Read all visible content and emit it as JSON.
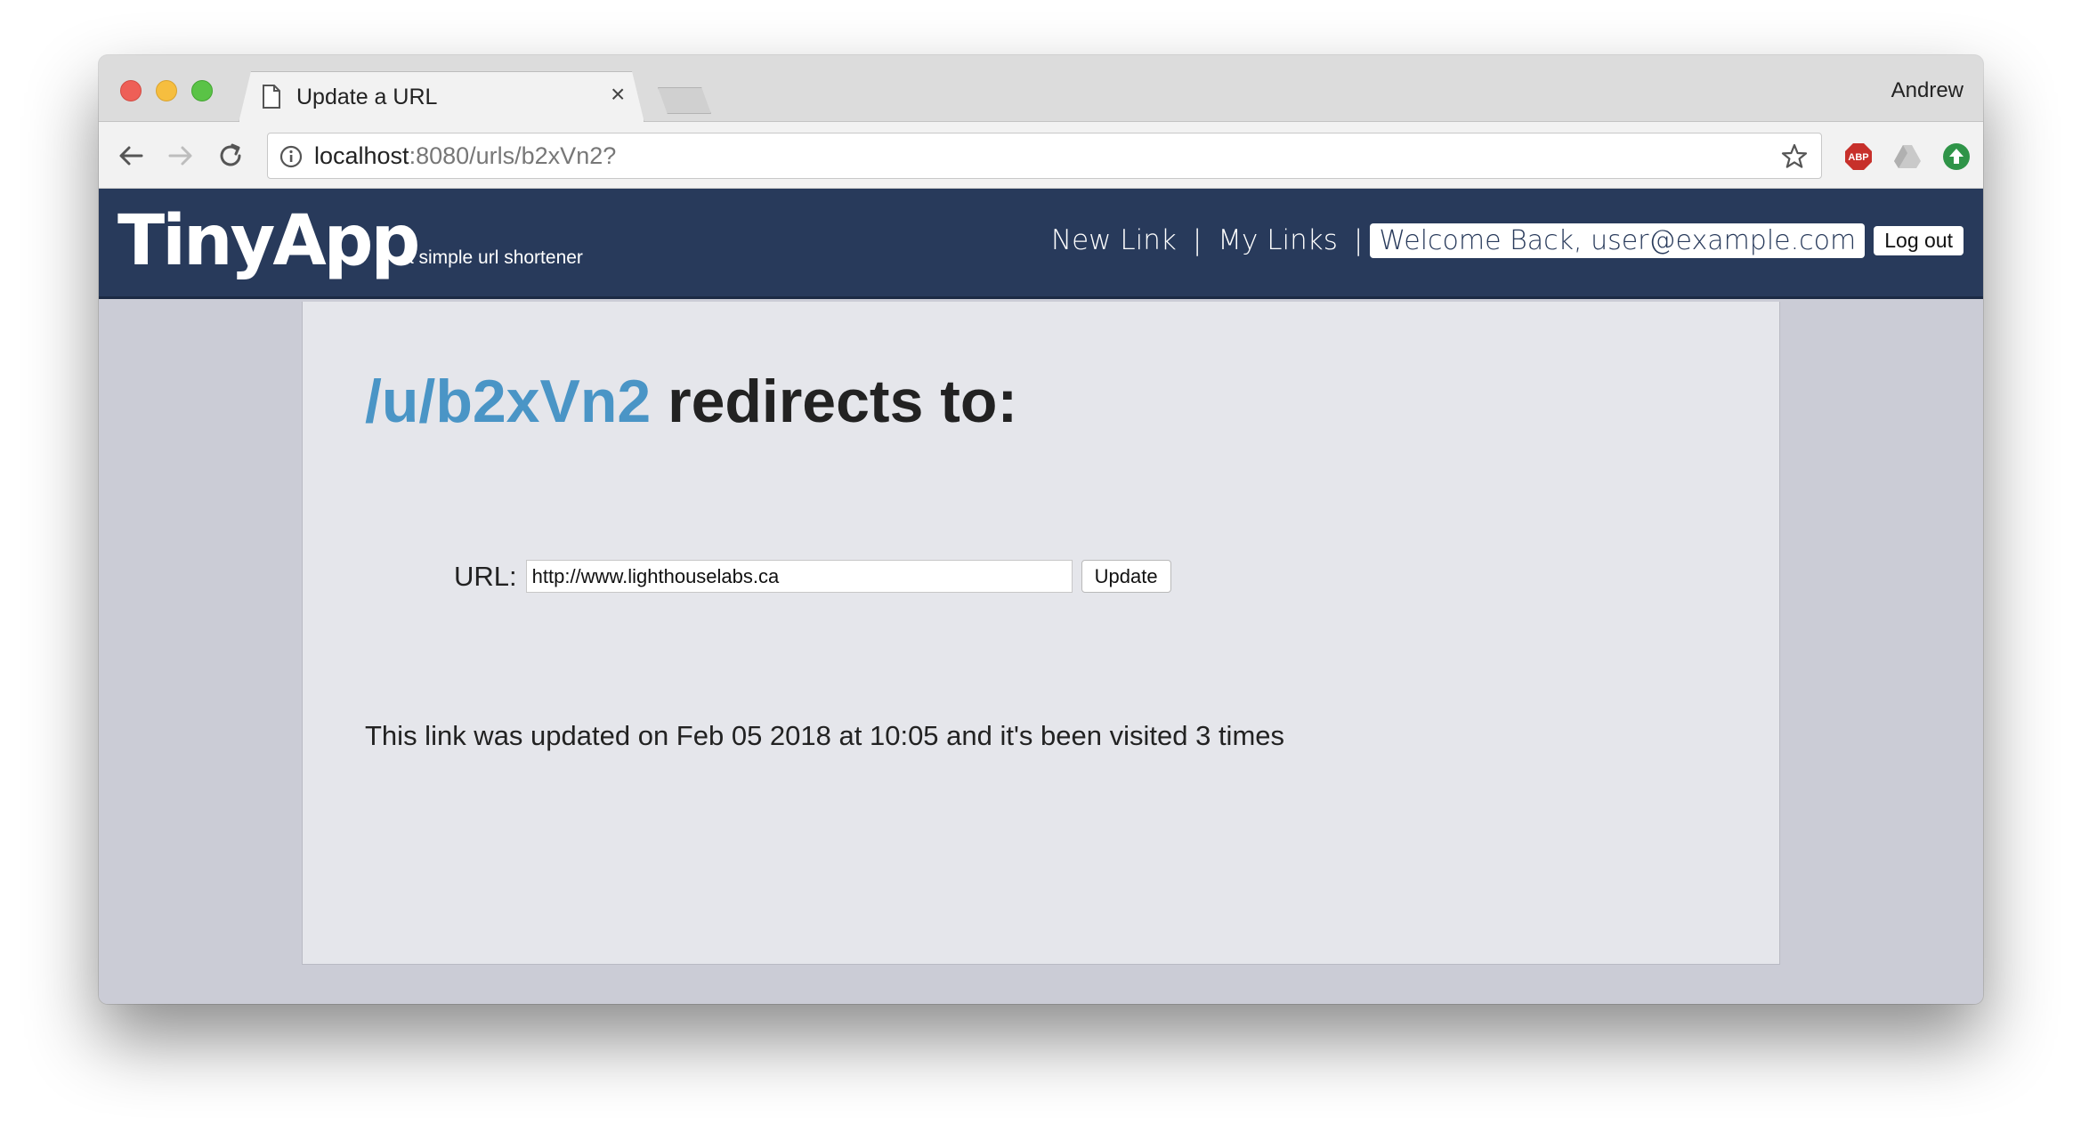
{
  "browser": {
    "tab_title": "Update a URL",
    "profile_name": "Andrew",
    "address": {
      "host": "localhost",
      "rest": ":8080/urls/b2xVn2?"
    },
    "extensions": [
      "adblock-plus-icon",
      "drive-icon",
      "upload-extension-icon"
    ]
  },
  "app": {
    "brand": "TinyApp",
    "tagline": "a simple url shortener",
    "nav": {
      "new_link": "New Link",
      "sep": "|",
      "my_links": "My Links",
      "welcome": "Welcome Back, user@example.com",
      "logout": "Log out"
    }
  },
  "main": {
    "short_path": "/u/b2xVn2",
    "heading_suffix": " redirects to:",
    "url_label": "URL:",
    "url_value": "http://www.lighthouselabs.ca",
    "update_button": "Update",
    "info_text": "This link was updated on Feb 05 2018 at 10:05 and it's been visited 3 times"
  },
  "colors": {
    "appbar": "#283a5b",
    "accent_link": "#4a95c6",
    "page_bg": "#cbccd6",
    "card_bg": "#e5e6eb"
  }
}
